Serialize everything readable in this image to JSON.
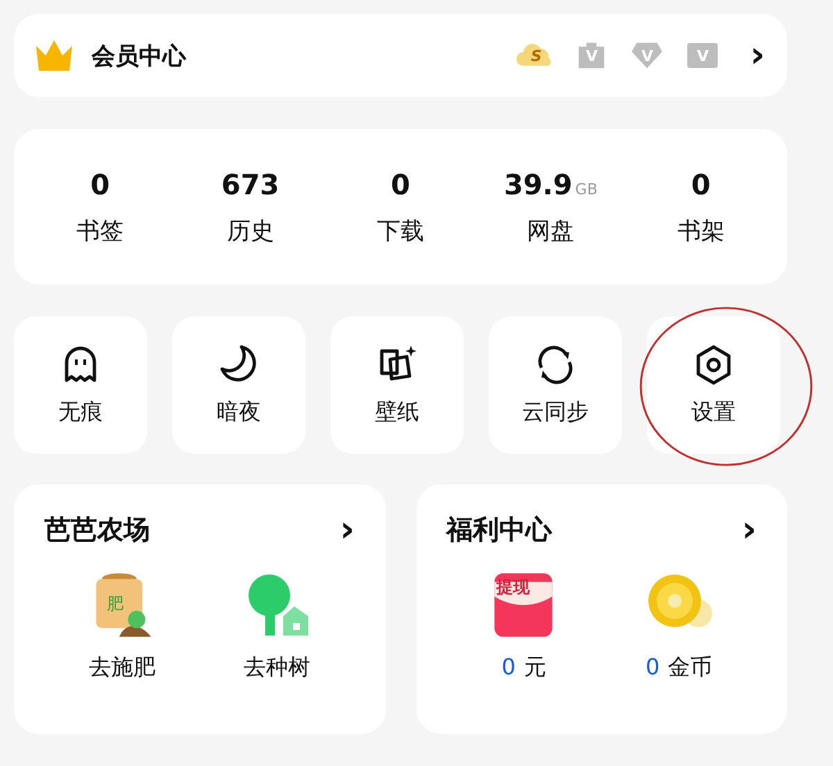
{
  "member": {
    "title": "会员中心",
    "badges": [
      {
        "kind": "cloud",
        "letter": "S"
      },
      {
        "kind": "bag",
        "letter": "V"
      },
      {
        "kind": "diamond",
        "letter": "V"
      },
      {
        "kind": "tag",
        "letter": "V"
      }
    ],
    "chevron": "›"
  },
  "stats": [
    {
      "value": "0",
      "label": "书签"
    },
    {
      "value": "673",
      "label": "历史"
    },
    {
      "value": "0",
      "label": "下载"
    },
    {
      "value": "39.9",
      "unit": "GB",
      "label": "网盘"
    },
    {
      "value": "0",
      "label": "书架"
    }
  ],
  "shortcuts": [
    {
      "kind": "ghost",
      "label": "无痕",
      "circled": false
    },
    {
      "kind": "moon",
      "label": "暗夜",
      "circled": false
    },
    {
      "kind": "wallpaper",
      "label": "壁纸",
      "circled": false
    },
    {
      "kind": "sync",
      "label": "云同步",
      "circled": false
    },
    {
      "kind": "settings",
      "label": "设置",
      "circled": true
    }
  ],
  "cards": [
    {
      "title": "芭芭农场",
      "chevron": "›",
      "items": [
        {
          "kind": "fertilizer",
          "icon_text": "肥",
          "label": "去施肥"
        },
        {
          "kind": "tree",
          "label": "去种树"
        }
      ]
    },
    {
      "title": "福利中心",
      "chevron": "›",
      "items": [
        {
          "kind": "redpacket",
          "icon_text": "提现",
          "amount": "0",
          "label": "元"
        },
        {
          "kind": "coin",
          "amount": "0",
          "label": "金币"
        }
      ]
    }
  ]
}
